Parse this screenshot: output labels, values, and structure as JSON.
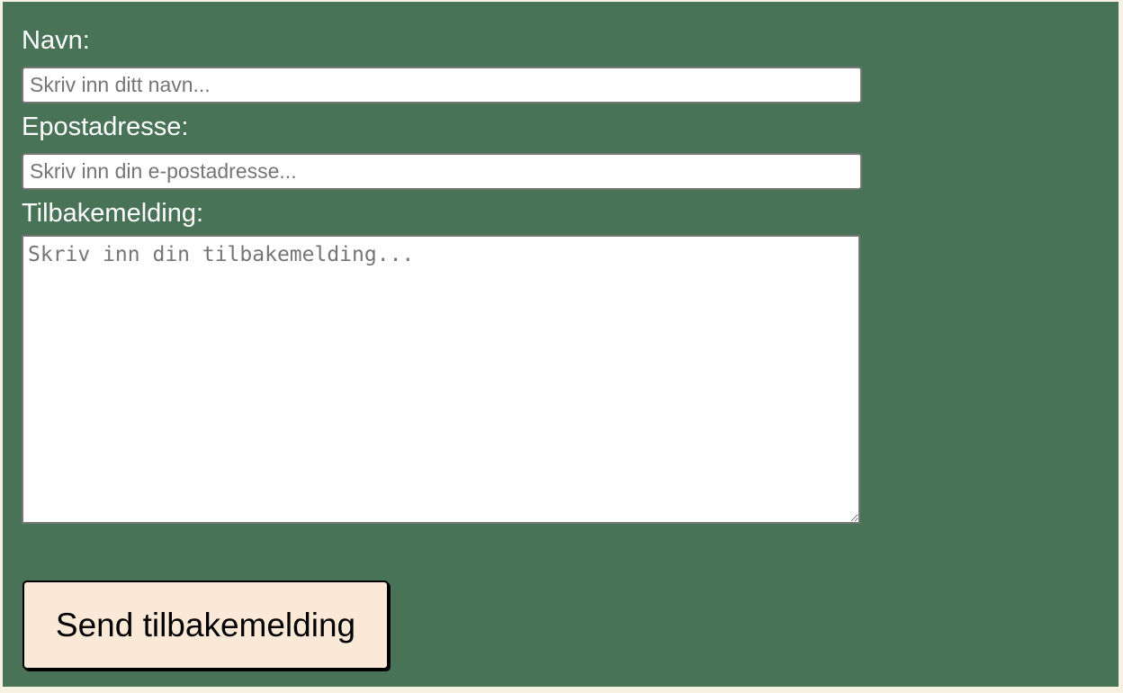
{
  "form": {
    "name_label": "Navn:",
    "name_placeholder": "Skriv inn ditt navn...",
    "email_label": "Epostadresse:",
    "email_placeholder": "Skriv inn din e-postadresse...",
    "feedback_label": "Tilbakemelding:",
    "feedback_placeholder": "Skriv inn din tilbakemelding...",
    "submit_label": "Send tilbakemelding"
  },
  "colors": {
    "panel_background": "#487357",
    "page_background": "#f6f1e3",
    "button_background": "#fbe9d8",
    "label_text": "#ffffff"
  }
}
